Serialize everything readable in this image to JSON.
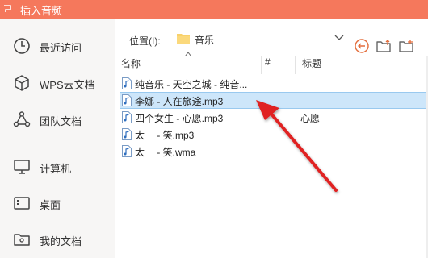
{
  "window": {
    "title": "插入音频"
  },
  "sidebar": {
    "items": [
      {
        "label": "最近访问",
        "icon": "clock-icon"
      },
      {
        "label": "WPS云文档",
        "icon": "cube-icon"
      },
      {
        "label": "团队文档",
        "icon": "team-icon"
      },
      {
        "label": "计算机",
        "icon": "monitor-icon"
      },
      {
        "label": "桌面",
        "icon": "desktop-icon"
      },
      {
        "label": "我的文档",
        "icon": "documents-folder-icon"
      }
    ]
  },
  "location": {
    "label": "位置(I):",
    "value": "音乐"
  },
  "toolbar": {
    "icons": [
      "back-icon",
      "up-folder-icon",
      "new-folder-icon"
    ]
  },
  "columns": {
    "name": "名称",
    "number": "#",
    "title": "标题"
  },
  "files": [
    {
      "name": "纯音乐 - 天空之城 - 纯音...",
      "title": "",
      "selected": false
    },
    {
      "name": "李娜 - 人在旅途.mp3",
      "title": "",
      "selected": true
    },
    {
      "name": "四个女生 - 心愿.mp3",
      "title": "心愿",
      "selected": false
    },
    {
      "name": "太一 - 笑.mp3",
      "title": "",
      "selected": false
    },
    {
      "name": "太一 - 笑.wma",
      "title": "",
      "selected": false
    }
  ],
  "colors": {
    "titlebar": "#f5785c",
    "selection": "#cde6fa",
    "annotation_arrow": "#e02020"
  }
}
